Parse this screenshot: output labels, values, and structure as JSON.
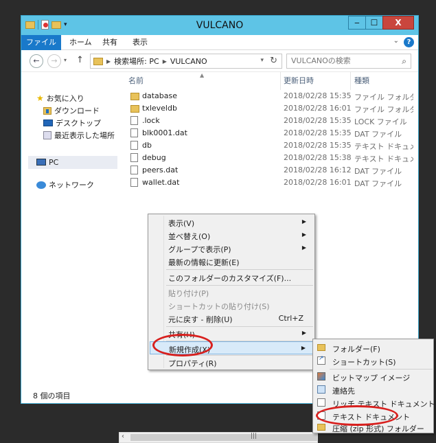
{
  "window": {
    "title": "VULCANO",
    "minimize": "‒",
    "maximize": "☐",
    "close": "X"
  },
  "ribbon": {
    "tabs": [
      "ファイル",
      "ホーム",
      "共有",
      "表示"
    ],
    "chevron": "⌄",
    "help": "?"
  },
  "address": {
    "back": "←",
    "forward": "→",
    "recent": "▾",
    "up": "↑",
    "crumbs": [
      "検索場所: PC",
      "VULCANO"
    ],
    "refresh": "↻",
    "search_placeholder": "VULCANOの検索",
    "search_icon": "⌕"
  },
  "nav": {
    "favorites": "お気に入り",
    "downloads": "ダウンロード",
    "desktop": "デスクトップ",
    "recent": "最近表示した場所",
    "pc": "PC",
    "network": "ネットワーク"
  },
  "columns": {
    "name": "名前",
    "date": "更新日時",
    "type": "種類"
  },
  "files": [
    {
      "name": "database",
      "date": "2018/02/28 15:35",
      "type": "ファイル フォルダー",
      "icon": "folder"
    },
    {
      "name": "txleveldb",
      "date": "2018/02/28 16:01",
      "type": "ファイル フォルダー",
      "icon": "folder"
    },
    {
      "name": ".lock",
      "date": "2018/02/28 15:35",
      "type": "LOCK ファイル",
      "icon": "file"
    },
    {
      "name": "blk0001.dat",
      "date": "2018/02/28 15:35",
      "type": "DAT ファイル",
      "icon": "file"
    },
    {
      "name": "db",
      "date": "2018/02/28 15:35",
      "type": "テキスト ドキュメント",
      "icon": "file"
    },
    {
      "name": "debug",
      "date": "2018/02/28 15:38",
      "type": "テキスト ドキュメント",
      "icon": "file"
    },
    {
      "name": "peers.dat",
      "date": "2018/02/28 16:12",
      "type": "DAT ファイル",
      "icon": "file"
    },
    {
      "name": "wallet.dat",
      "date": "2018/02/28 16:01",
      "type": "DAT ファイル",
      "icon": "file"
    }
  ],
  "status": {
    "count": "8 個の項目"
  },
  "context_menu": {
    "view": "表示(V)",
    "sort": "並べ替え(O)",
    "group": "グループで表示(P)",
    "refresh": "最新の情報に更新(E)",
    "customize": "このフォルダーのカスタマイズ(F)...",
    "paste": "貼り付け(P)",
    "paste_shortcut": "ショートカットの貼り付け(S)",
    "undo": "元に戻す - 削除(U)",
    "undo_shortcut": "Ctrl+Z",
    "share": "共有(H)",
    "new": "新規作成(X)",
    "properties": "プロパティ(R)"
  },
  "submenu": {
    "folder": "フォルダー(F)",
    "shortcut": "ショートカット(S)",
    "bitmap": "ビットマップ イメージ",
    "contact": "連絡先",
    "rtf": "リッチ テキスト ドキュメント",
    "text": "テキスト ドキュメント",
    "zip": "圧縮 (zip 形式) フォルダー"
  },
  "colors": {
    "title_bg": "#5ec4e6",
    "file_tab": "#1979ca",
    "close_btn": "#c9463d",
    "annotation": "#d8201e"
  }
}
